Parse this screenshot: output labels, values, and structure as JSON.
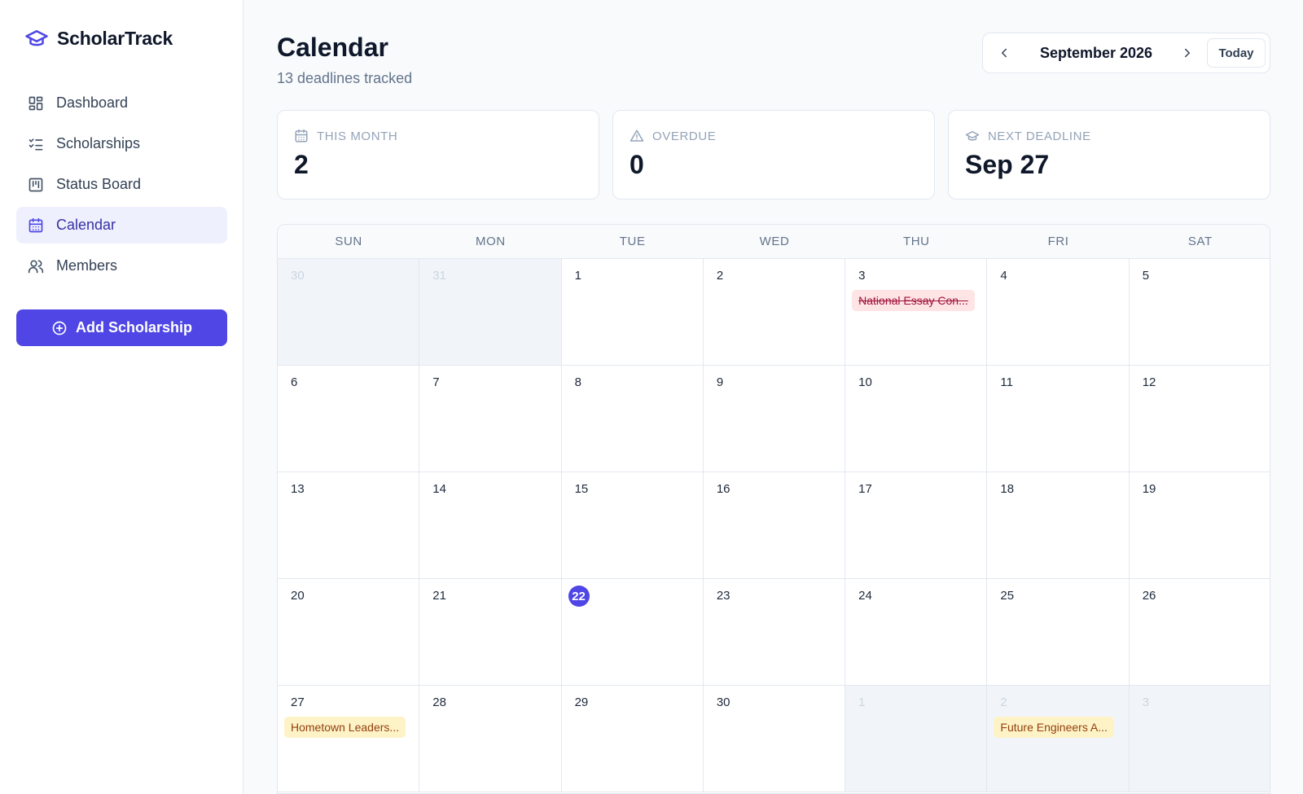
{
  "brand": {
    "name": "ScholarTrack",
    "icon": "graduation-cap-icon"
  },
  "sidebar": {
    "items": [
      {
        "label": "Dashboard",
        "icon": "grid-icon",
        "active": false
      },
      {
        "label": "Scholarships",
        "icon": "checklist-icon",
        "active": false
      },
      {
        "label": "Status Board",
        "icon": "kanban-icon",
        "active": false
      },
      {
        "label": "Calendar",
        "icon": "calendar-icon",
        "active": true
      },
      {
        "label": "Members",
        "icon": "users-icon",
        "active": false
      }
    ],
    "add_button": "Add Scholarship"
  },
  "header": {
    "title": "Calendar",
    "subtitle": "13 deadlines tracked",
    "month_label": "September 2026",
    "today_label": "Today"
  },
  "stats": [
    {
      "label": "THIS MONTH",
      "value": "2",
      "icon": "calendar-icon"
    },
    {
      "label": "OVERDUE",
      "value": "0",
      "icon": "warning-triangle-icon"
    },
    {
      "label": "NEXT DEADLINE",
      "value": "Sep 27",
      "icon": "graduation-cap-icon"
    }
  ],
  "calendar": {
    "weekdays": [
      "SUN",
      "MON",
      "TUE",
      "WED",
      "THU",
      "FRI",
      "SAT"
    ],
    "today": 22,
    "weeks": [
      [
        {
          "d": "30",
          "other": true
        },
        {
          "d": "31",
          "other": true
        },
        {
          "d": "1"
        },
        {
          "d": "2"
        },
        {
          "d": "3",
          "event": {
            "title": "National Essay Con...",
            "style": "red"
          }
        },
        {
          "d": "4"
        },
        {
          "d": "5"
        }
      ],
      [
        {
          "d": "6"
        },
        {
          "d": "7"
        },
        {
          "d": "8"
        },
        {
          "d": "9"
        },
        {
          "d": "10"
        },
        {
          "d": "11"
        },
        {
          "d": "12"
        }
      ],
      [
        {
          "d": "13"
        },
        {
          "d": "14"
        },
        {
          "d": "15"
        },
        {
          "d": "16"
        },
        {
          "d": "17"
        },
        {
          "d": "18"
        },
        {
          "d": "19"
        }
      ],
      [
        {
          "d": "20"
        },
        {
          "d": "21"
        },
        {
          "d": "22",
          "today": true
        },
        {
          "d": "23"
        },
        {
          "d": "24"
        },
        {
          "d": "25"
        },
        {
          "d": "26"
        }
      ],
      [
        {
          "d": "27",
          "event": {
            "title": "Hometown Leaders...",
            "style": "amber"
          }
        },
        {
          "d": "28"
        },
        {
          "d": "29"
        },
        {
          "d": "30"
        },
        {
          "d": "1",
          "other": true
        },
        {
          "d": "2",
          "other": true,
          "event": {
            "title": "Future Engineers A...",
            "style": "amber"
          }
        },
        {
          "d": "3",
          "other": true
        }
      ]
    ]
  },
  "colors": {
    "accent": "#4f46e5",
    "active_nav_bg": "#eef0fe",
    "event_red_bg": "#ffe4e6",
    "event_amber_bg": "#fef3c7"
  }
}
